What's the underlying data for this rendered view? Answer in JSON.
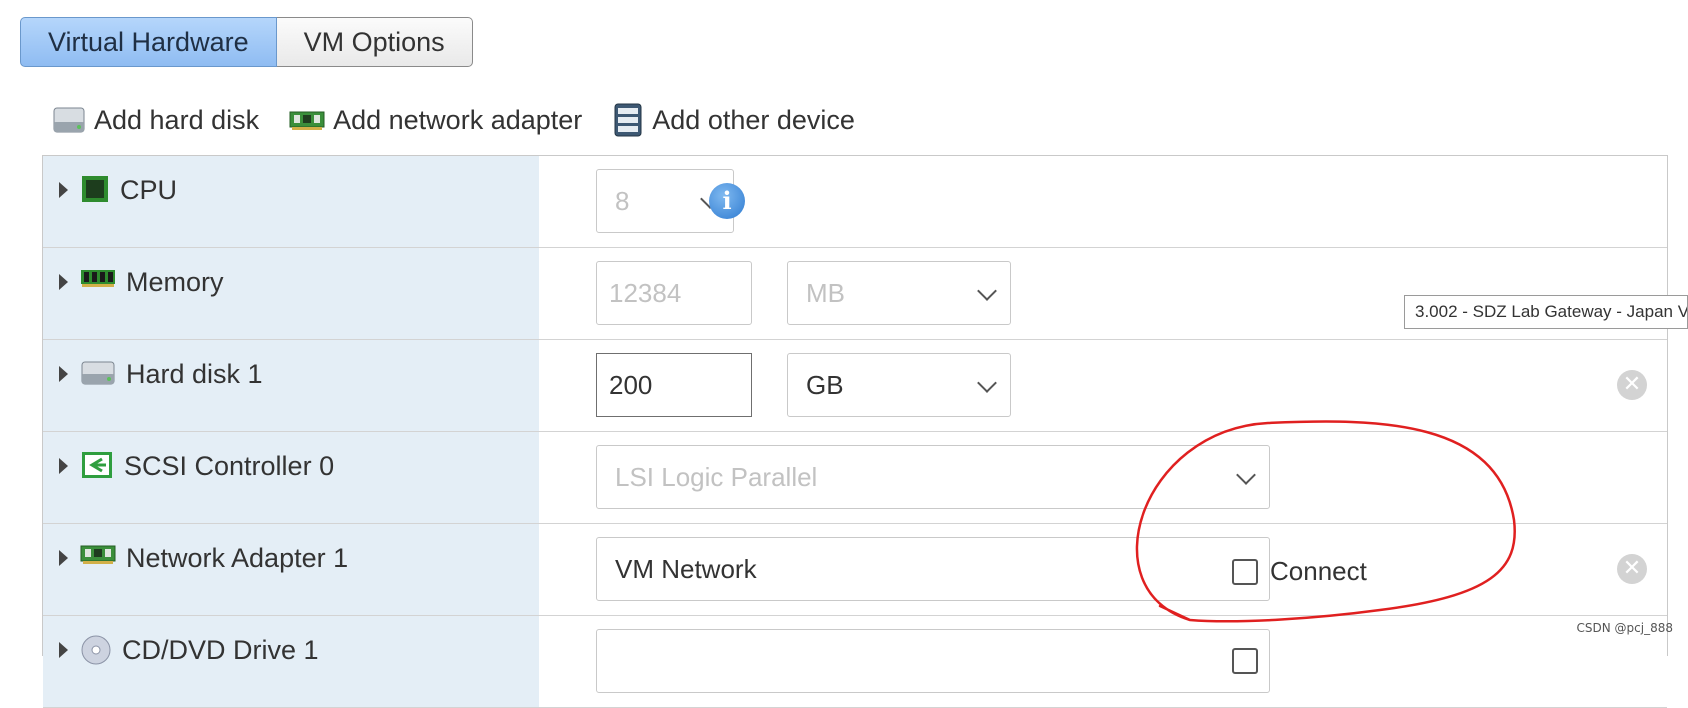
{
  "tabs": [
    {
      "label": "Virtual Hardware"
    },
    {
      "label": "VM Options"
    }
  ],
  "toolbar": {
    "add_hard_disk": "Add hard disk",
    "add_network_adapter": "Add network adapter",
    "add_other_device": "Add other device"
  },
  "devices": {
    "cpu": {
      "label": "CPU",
      "value": "8"
    },
    "memory": {
      "label": "Memory",
      "value": "12384",
      "unit": "MB"
    },
    "hard_disk": {
      "label": "Hard disk 1",
      "value": "200",
      "unit": "GB"
    },
    "scsi": {
      "label": "SCSI Controller 0",
      "value": "LSI Logic Parallel"
    },
    "network": {
      "label": "Network Adapter 1",
      "value": "VM Network",
      "connect_label": "Connect"
    },
    "cdrom": {
      "label": "CD/DVD Drive 1"
    }
  },
  "tooltip": "3.002 - SDZ Lab Gateway - Japan V",
  "watermark": "CSDN @pcj_888",
  "colors": {
    "annotation": "#e02020",
    "active_tab": "#9fc6f5",
    "label_column": "#e4eef6"
  }
}
